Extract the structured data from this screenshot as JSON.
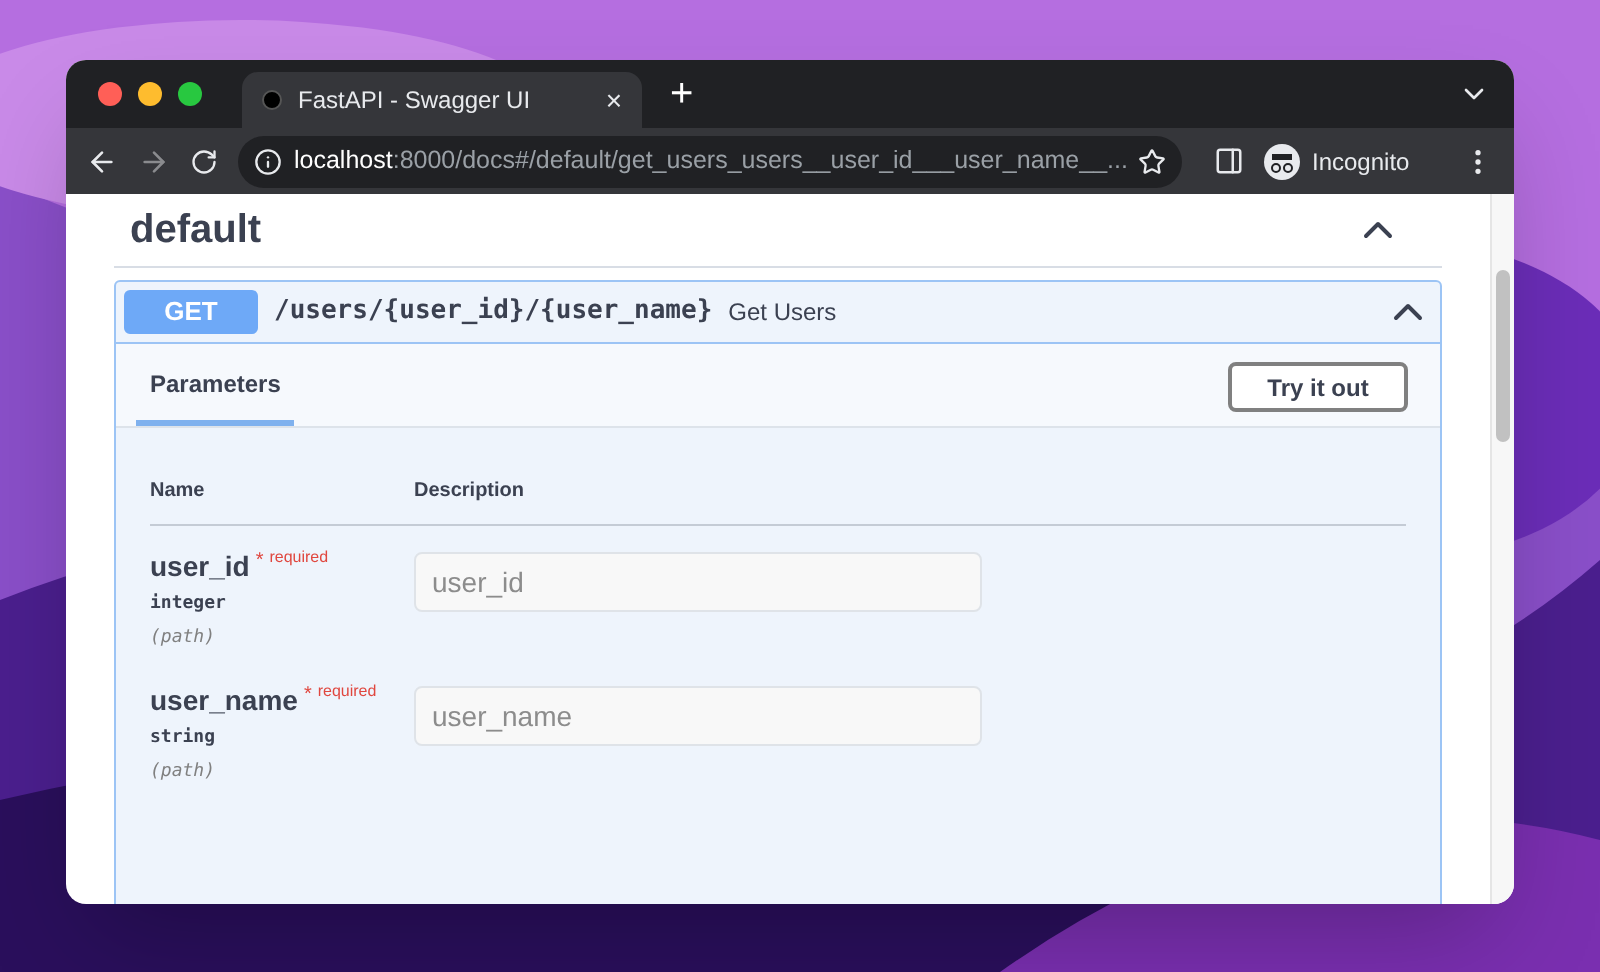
{
  "browser": {
    "tab": {
      "title": "FastAPI - Swagger UI",
      "close": "×"
    },
    "new_tab": "+",
    "address": {
      "host": "localhost",
      "path": ":8000/docs#/default/get_users_users__user_id___user_name__..."
    },
    "profile": "Incognito"
  },
  "section": {
    "title": "default",
    "expanded": true
  },
  "operation": {
    "method": "GET",
    "path": "/users/{user_id}/{user_name}",
    "summary": "Get Users",
    "expanded": true,
    "tabs": [
      {
        "label": "Parameters",
        "selected": true
      }
    ],
    "try_button": "Try it out",
    "columns": [
      "Name",
      "Description"
    ],
    "parameters": [
      {
        "name": "user_id",
        "required": true,
        "mark": "*",
        "required_label": "required",
        "type": "integer",
        "location": "(path)",
        "placeholder": "user_id"
      },
      {
        "name": "user_name",
        "required": true,
        "mark": "*",
        "required_label": "required",
        "type": "string",
        "location": "(path)",
        "placeholder": "user_name"
      }
    ]
  }
}
